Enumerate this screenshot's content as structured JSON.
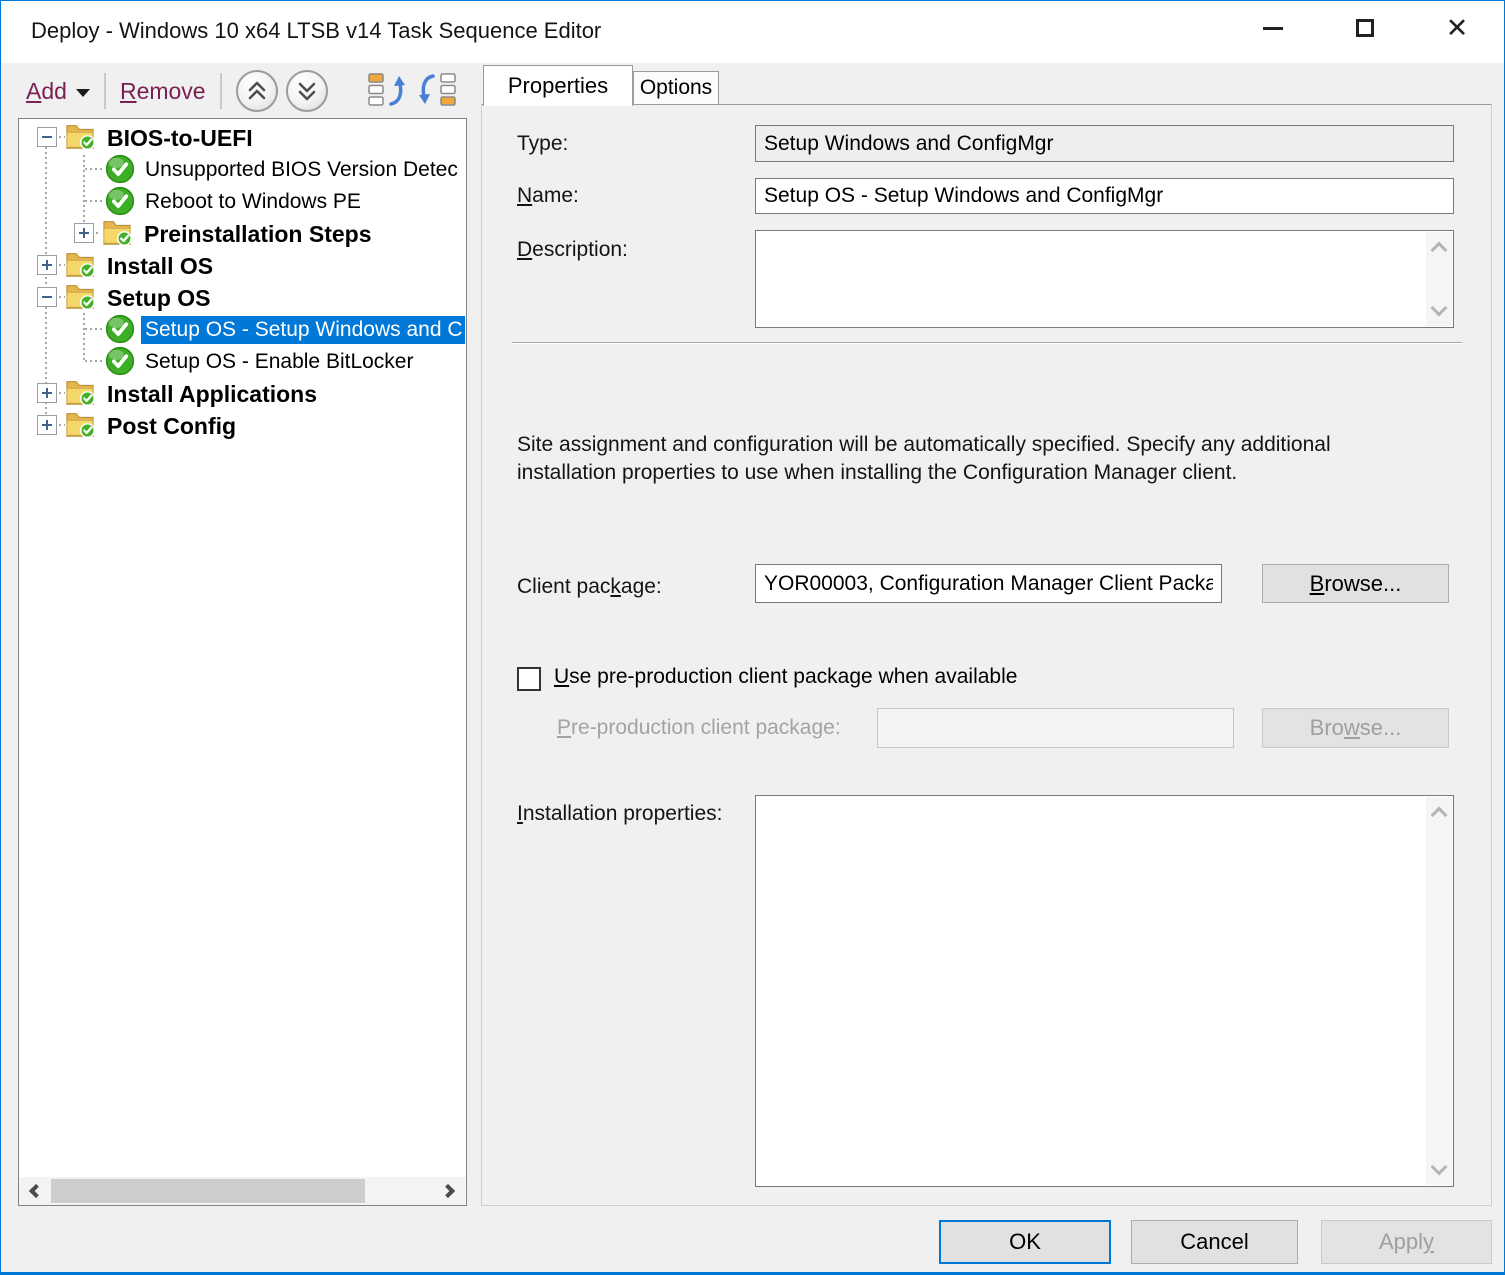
{
  "window": {
    "title": "Deploy - Windows 10 x64 LTSB v14 Task Sequence Editor"
  },
  "toolbar": {
    "add": {
      "text": "Add",
      "mnemonic": "A"
    },
    "remove": {
      "text": "Remove",
      "mnemonic": "R"
    }
  },
  "tree": {
    "items": [
      {
        "label": "BIOS-to-UEFI",
        "icon": "folder-check",
        "expander": "minus",
        "level": 0,
        "bold": true,
        "selected": false
      },
      {
        "label": "Unsupported BIOS Version Detec",
        "icon": "check-circle",
        "expander": null,
        "level": 1,
        "bold": false,
        "selected": false
      },
      {
        "label": "Reboot to Windows PE",
        "icon": "check-circle",
        "expander": null,
        "level": 1,
        "bold": false,
        "selected": false
      },
      {
        "label": "Preinstallation Steps",
        "icon": "folder-check",
        "expander": "plus",
        "level": 1,
        "bold": true,
        "selected": false
      },
      {
        "label": "Install OS",
        "icon": "folder-check",
        "expander": "plus",
        "level": 0,
        "bold": true,
        "selected": false
      },
      {
        "label": "Setup OS",
        "icon": "folder-check",
        "expander": "minus",
        "level": 0,
        "bold": true,
        "selected": false
      },
      {
        "label": "Setup OS - Setup Windows and C",
        "icon": "check-circle",
        "expander": null,
        "level": 1,
        "bold": false,
        "selected": true
      },
      {
        "label": "Setup OS - Enable BitLocker",
        "icon": "check-circle",
        "expander": null,
        "level": 1,
        "bold": false,
        "selected": false
      },
      {
        "label": "Install Applications",
        "icon": "folder-check",
        "expander": "plus",
        "level": 0,
        "bold": true,
        "selected": false
      },
      {
        "label": "Post Config",
        "icon": "folder-check",
        "expander": "plus",
        "level": 0,
        "bold": true,
        "selected": false
      }
    ]
  },
  "tabs": {
    "properties": "Properties",
    "options": "Options"
  },
  "form": {
    "type_label": "Type:",
    "type_value": "Setup Windows and ConfigMgr",
    "name_label": {
      "text": "Name:",
      "mnemonic": "N"
    },
    "name_value": "Setup OS - Setup Windows and ConfigMgr",
    "description_label": {
      "text": "Description:",
      "mnemonic": "D"
    },
    "description_value": "",
    "info_text": "Site assignment and configuration will be automatically specified. Specify any additional installation properties to use when installing the Configuration Manager client.",
    "client_package_label": {
      "text": "Client package:",
      "mnemonic": "k"
    },
    "client_package_value": "YOR00003, Configuration Manager Client Packa",
    "client_package_browse": {
      "text": "Browse...",
      "mnemonic": "B"
    },
    "preprod_checkbox": {
      "text": "Use pre-production client package when available",
      "mnemonic": "U",
      "checked": false
    },
    "preprod_label": {
      "text": "Pre-production client package:",
      "mnemonic": "P"
    },
    "preprod_value": "",
    "preprod_browse": {
      "text": "Browse...",
      "mnemonic": "w"
    },
    "install_props_label": {
      "text": "Installation properties:",
      "mnemonic": "I"
    },
    "install_props_value": ""
  },
  "footer": {
    "ok": "OK",
    "cancel": "Cancel",
    "apply": {
      "text": "Apply",
      "mnemonic": "y",
      "disabled": true
    }
  },
  "colors": {
    "accent": "#0078d7",
    "selection": "#0078d7",
    "toolbar_link": "#7a2152",
    "check_green": "#3fae27",
    "folder_yellow": "#f2c84b"
  }
}
